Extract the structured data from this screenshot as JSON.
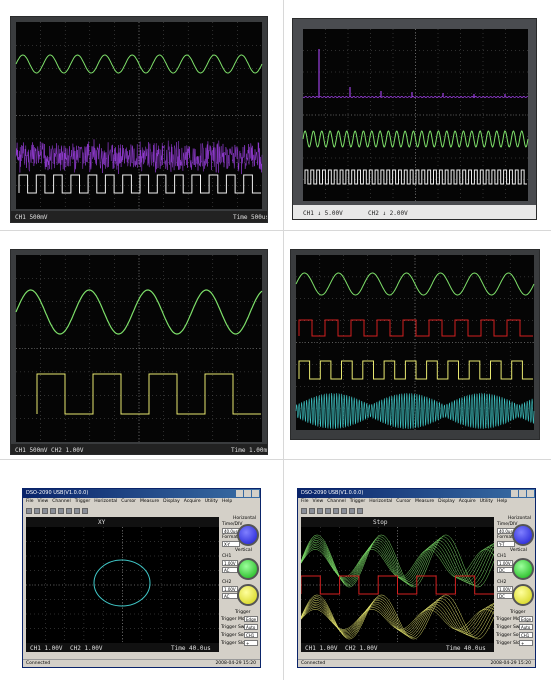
{
  "panels": [
    {
      "id": "scope-1",
      "traces": [
        "sine-green",
        "noise-purple",
        "square-white"
      ],
      "status_left": "CH1 500mV",
      "status_right": "Time 500us"
    },
    {
      "id": "scope-2",
      "traces": [
        "fft-purple",
        "sine-green",
        "square-white"
      ],
      "status_left": "CH1 ↓ 5.00V",
      "status_mid": "CH2 ↓ 2.00V"
    },
    {
      "id": "scope-3",
      "traces": [
        "sine-green",
        "square-yellow"
      ],
      "status_left": "CH1 500mV",
      "status_mid": "CH2 1.00V",
      "status_right": "Time 1.00ms"
    },
    {
      "id": "scope-4",
      "traces": [
        "sine-green",
        "square-red",
        "square-yellow",
        "am-cyan"
      ]
    },
    {
      "id": "app-xy",
      "title": "DSO-2090 USB(V1.0.0.0)",
      "menu": [
        "File",
        "View",
        "Channel",
        "Trigger",
        "Horizontal",
        "Cursor",
        "Measure",
        "Display",
        "Acquire",
        "Utility",
        "Help"
      ],
      "mode_label": "XY",
      "right_panel": {
        "horizontal": "Horizontal",
        "time_div_label": "Time/DIV",
        "time_div": "40.0us",
        "format_label": "Format",
        "format": "X-Y",
        "vertical": "Vertical",
        "ch1": "CH1",
        "ch1_volt": "1.00V",
        "ch1_coup": "AC",
        "ch2": "CH2",
        "ch2_volt": "1.00V",
        "ch2_coup": "AC",
        "trigger": "Trigger",
        "mode_label": "Trigger Mode",
        "mode": "Edge",
        "sweep_label": "Trigger Sweep",
        "sweep": "Auto",
        "source_label": "Trigger Source",
        "source": "CH1",
        "slope_label": "Trigger Slope",
        "slope": "+"
      },
      "bottom_left": "CH1 1.00V",
      "bottom_mid": "CH2 1.00V",
      "bottom_right": "Time 40.0us",
      "status": "Connected",
      "status_date": "2008-04-29 15:20"
    },
    {
      "id": "app-yt",
      "title": "DSO-2090 USB(V1.0.0.0)",
      "menu": [
        "File",
        "View",
        "Channel",
        "Trigger",
        "Horizontal",
        "Cursor",
        "Measure",
        "Display",
        "Acquire",
        "Utility",
        "Help"
      ],
      "mode_label": "Stop",
      "right_panel": {
        "horizontal": "Horizontal",
        "time_div_label": "Time/DIV",
        "time_div": "40.0us",
        "format_label": "Format",
        "format": "Y-T",
        "vertical": "Vertical",
        "ch1": "CH1",
        "ch1_volt": "1.00V",
        "ch1_coup": "DC",
        "ch2": "CH2",
        "ch2_volt": "1.00V",
        "ch2_coup": "DC",
        "trigger": "Trigger",
        "mode_label": "Trigger Mode",
        "mode": "Edge",
        "sweep_label": "Trigger Sweep",
        "sweep": "Auto",
        "source_label": "Trigger Source",
        "source": "CH1",
        "slope_label": "Trigger Slope",
        "slope": "+"
      },
      "bottom_left": "CH1 1.00V",
      "bottom_mid": "CH2 1.00V",
      "bottom_right": "Time 40.0us",
      "status": "Connected",
      "status_date": "2008-04-29 15:20"
    }
  ],
  "colors": {
    "bezel": "#3a3c3e",
    "screen": "#050505",
    "grid": "#5a5a5a",
    "green": "#7ee06a",
    "purple": "#9b3fe0",
    "white": "#f0f0f0",
    "yellow": "#e8e870",
    "red": "#d42020",
    "cyan": "#40c8c8"
  }
}
